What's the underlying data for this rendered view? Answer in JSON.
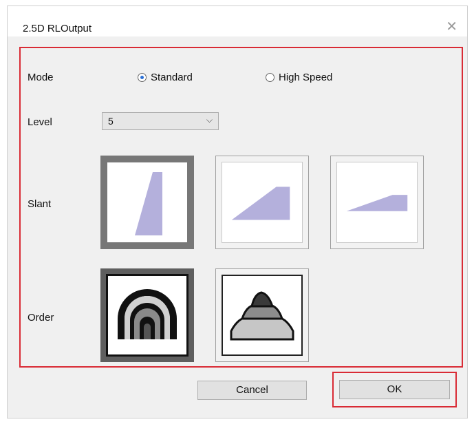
{
  "window": {
    "title": "2.5D RLOutput",
    "close_glyph": "✕"
  },
  "mode": {
    "label": "Mode",
    "options": [
      {
        "label": "Standard",
        "selected": true
      },
      {
        "label": "High Speed",
        "selected": false
      }
    ]
  },
  "level": {
    "label": "Level",
    "value": "5",
    "chevron": "⌵"
  },
  "slant": {
    "label": "Slant",
    "selected_index": 0
  },
  "order": {
    "label": "Order",
    "selected_index": 0
  },
  "buttons": {
    "cancel": "Cancel",
    "ok": "OK"
  },
  "colors": {
    "shape_fill": "#b4b0dc",
    "highlight": "#d92b35"
  }
}
